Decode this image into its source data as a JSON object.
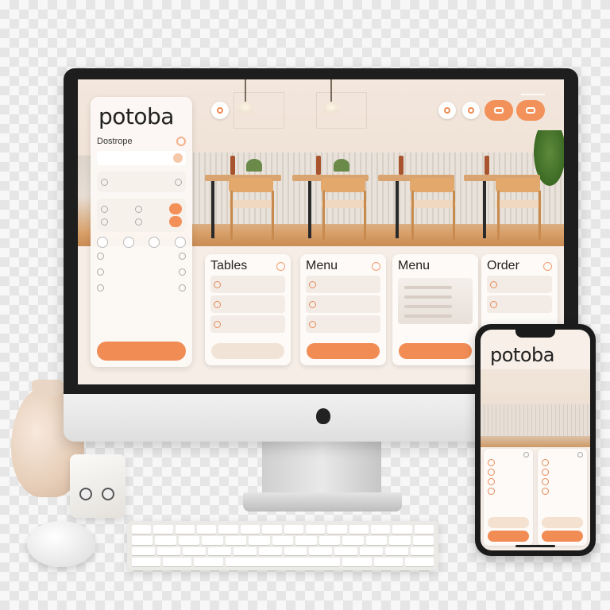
{
  "brand": {
    "name": "potoba",
    "accent": "#f28c55"
  },
  "sidebar": {
    "title": "Dostrope",
    "icons": [
      "settings-icon",
      "chevron-icon",
      "user-icon",
      "bell-icon",
      "calendar-icon"
    ]
  },
  "cards": [
    {
      "title": "Tables"
    },
    {
      "title": "Menu"
    },
    {
      "title": "Menu"
    },
    {
      "title": "Order"
    }
  ],
  "phone": {
    "brand": "potoba"
  }
}
